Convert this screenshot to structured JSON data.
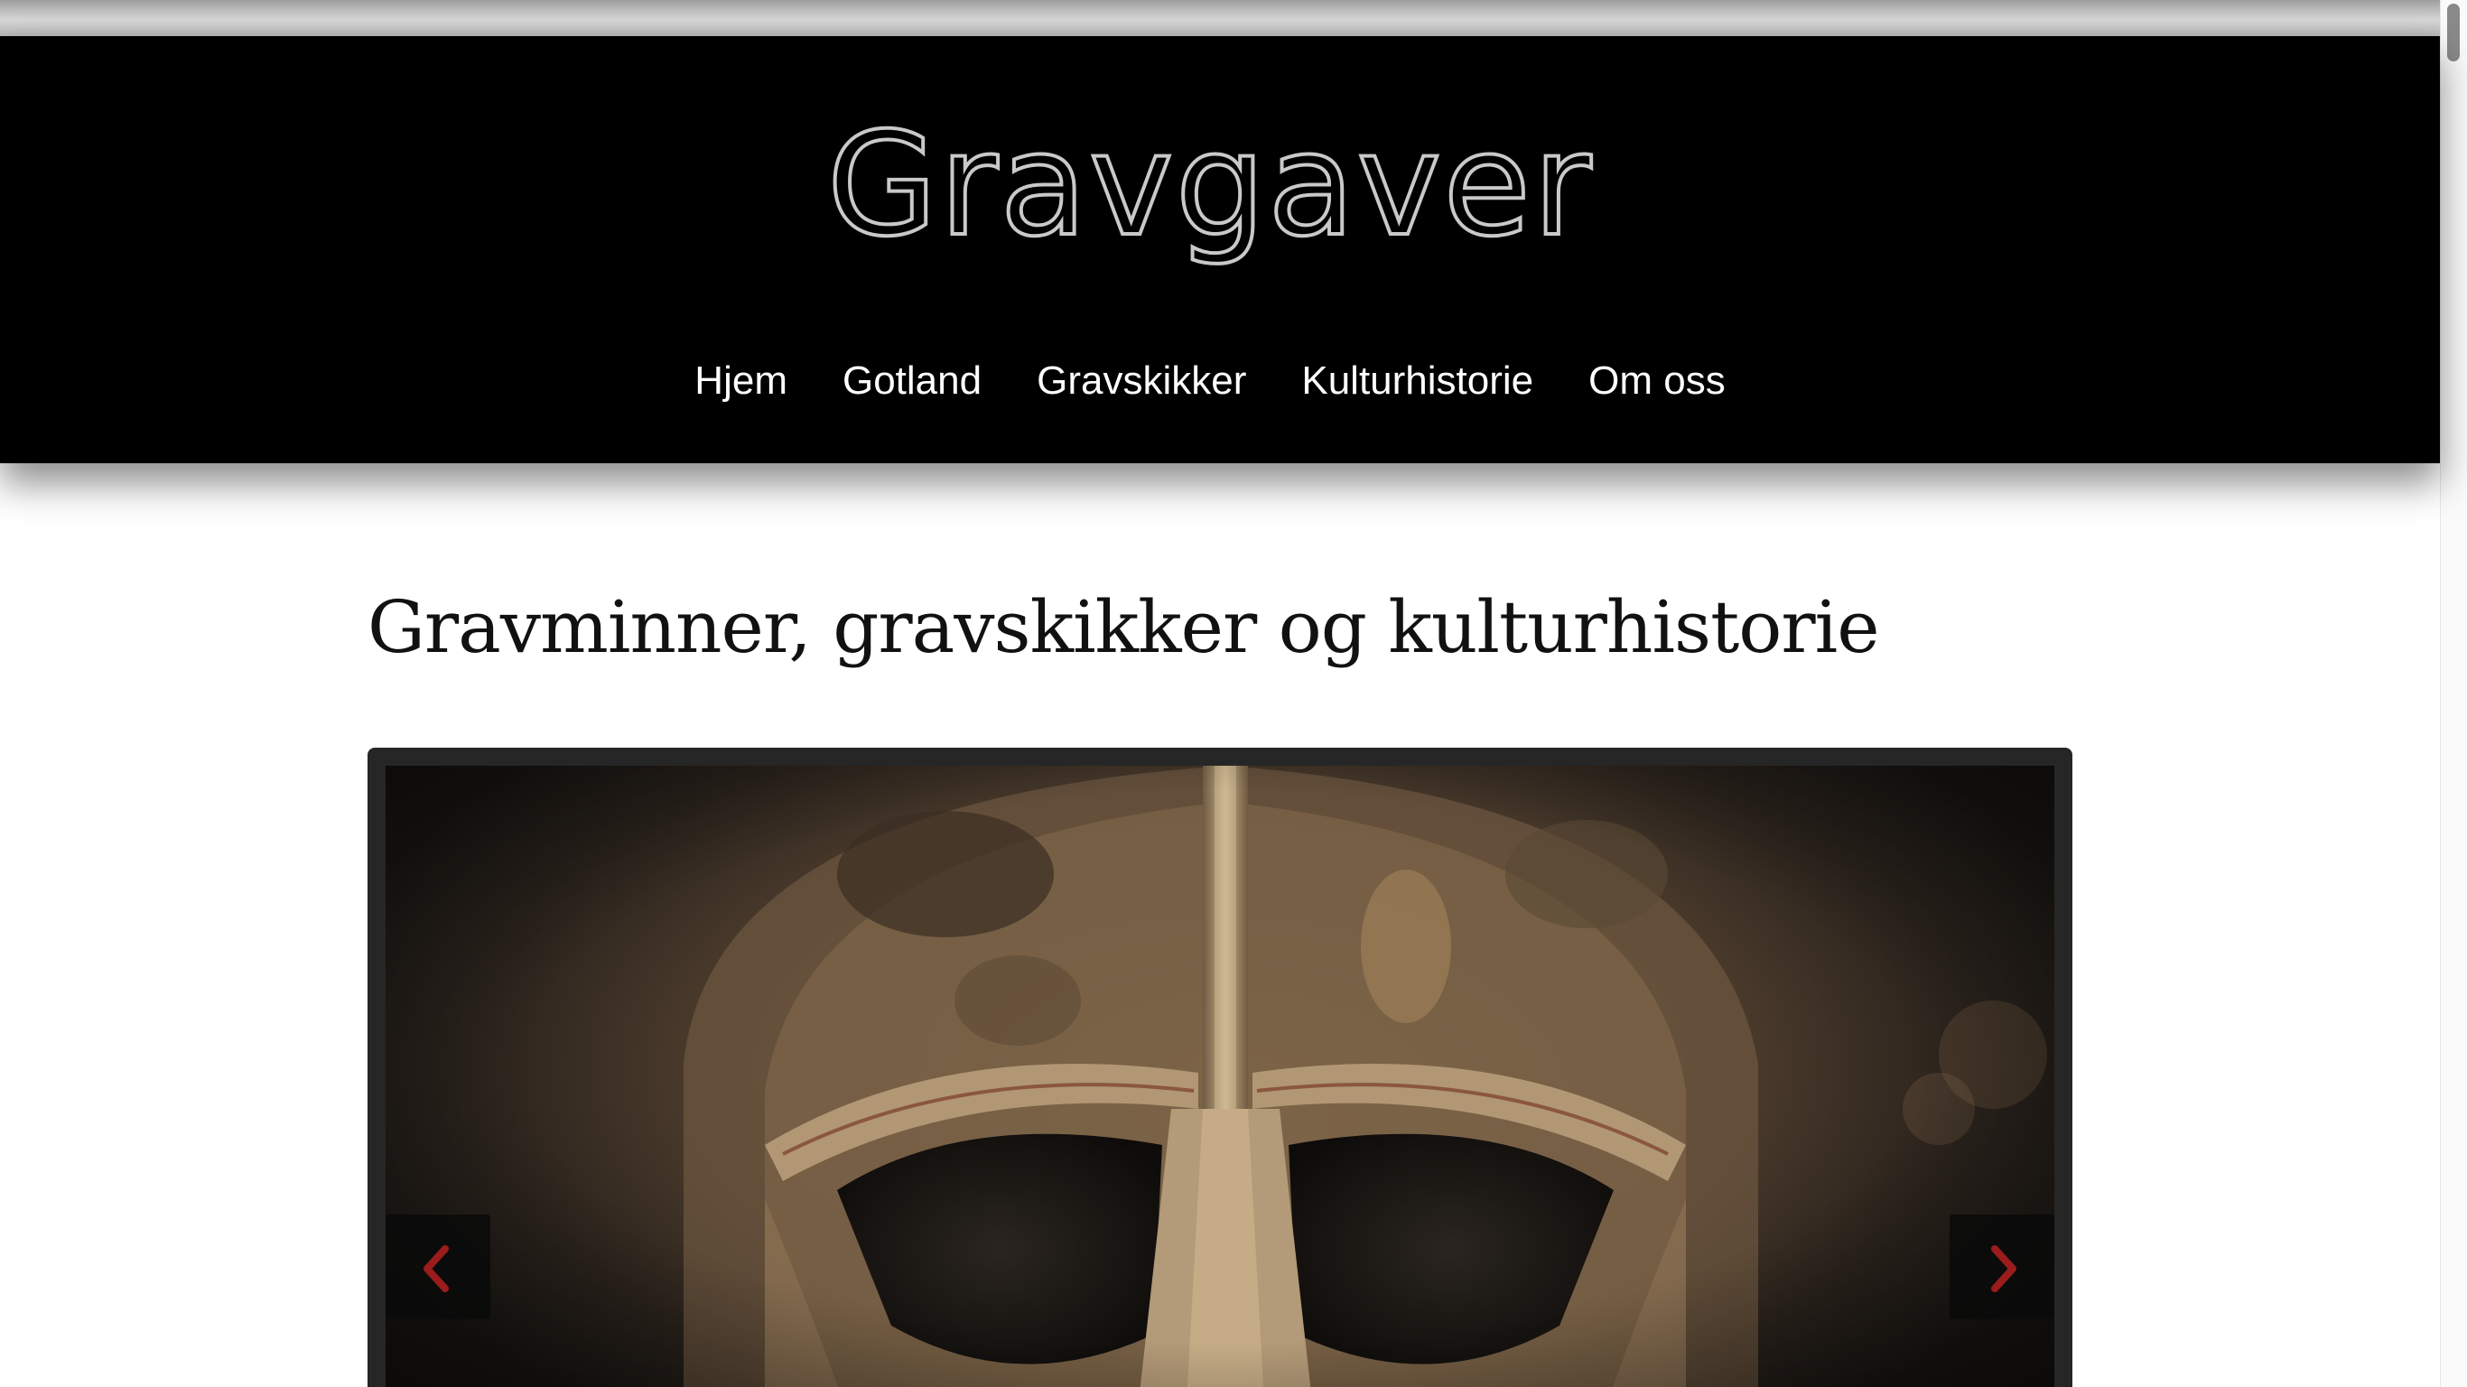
{
  "site": {
    "logo_text": "Gravgaver"
  },
  "nav": {
    "items": [
      {
        "label": "Hjem"
      },
      {
        "label": "Gotland"
      },
      {
        "label": "Gravskikker"
      },
      {
        "label": "Kulturhistorie"
      },
      {
        "label": "Om oss"
      }
    ]
  },
  "main": {
    "headline": "Gravminner, gravskikker og kulturhistorie"
  },
  "slider": {
    "prev_icon": "chevron-left-icon",
    "next_icon": "chevron-right-icon",
    "arrow_color": "#9b1c1c",
    "image_subject": "helmet"
  },
  "colors": {
    "header_bg": "#000000",
    "nav_text": "#ffffff",
    "arrow_accent": "#9b1c1c"
  }
}
